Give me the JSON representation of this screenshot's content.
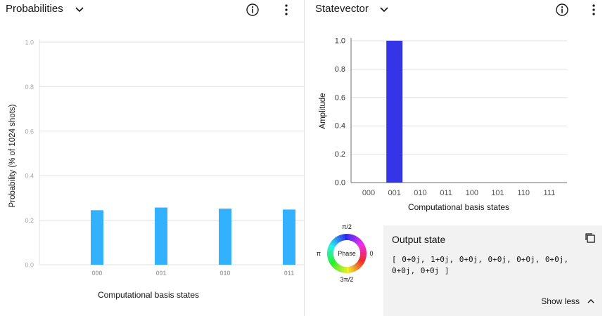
{
  "left_panel": {
    "title": "Probabilities",
    "icons": {
      "dropdown": "chevron-down-icon",
      "info": "info-icon",
      "menu": "overflow-menu-icon"
    }
  },
  "right_panel": {
    "title": "Statevector",
    "icons": {
      "dropdown": "chevron-down-icon",
      "info": "info-icon",
      "menu": "overflow-menu-icon"
    }
  },
  "output_state": {
    "title": "Output state",
    "value": "[ 0+0j, 1+0j, 0+0j, 0+0j, 0+0j, 0+0j, 0+0j, 0+0j ]",
    "toggle_label": "Show less",
    "copy_icon": "copy-icon"
  },
  "phase_wheel": {
    "center_label": "Phase",
    "top": "π/2",
    "left": "π",
    "right": "0",
    "bottom": "3π/2"
  },
  "colors": {
    "probability_bar": "#33b1ff",
    "amplitude_bar": "#3535e8",
    "grid": "#e0e0e0",
    "output_bg": "#f2f2f2"
  },
  "chart_data": [
    {
      "type": "bar",
      "title": "",
      "ylabel": "Probability (% of 1024 shots)",
      "xlabel": "Computational basis states",
      "categories": [
        "000",
        "001",
        "010",
        "011"
      ],
      "values": [
        0.245,
        0.257,
        0.252,
        0.248
      ],
      "ylim": [
        0,
        1.0
      ],
      "yticks": [
        "0.0",
        "0.2",
        "0.4",
        "0.6",
        "0.8",
        "1.0"
      ],
      "grid": true
    },
    {
      "type": "bar",
      "title": "",
      "ylabel": "Amplitude",
      "xlabel": "Computational basis states",
      "categories": [
        "000",
        "001",
        "010",
        "011",
        "100",
        "101",
        "110",
        "111"
      ],
      "values": [
        0,
        1.0,
        0,
        0,
        0,
        0,
        0,
        0
      ],
      "ylim": [
        0,
        1.0
      ],
      "yticks": [
        "0.0",
        "0.2",
        "0.4",
        "0.6",
        "0.8",
        "1.0"
      ],
      "grid": true
    }
  ]
}
